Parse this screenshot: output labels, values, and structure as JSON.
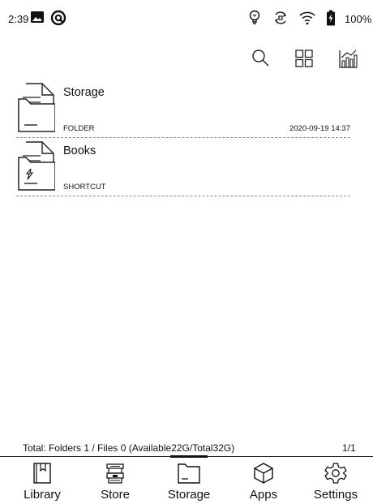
{
  "status": {
    "time": "2:39",
    "battery": "100%"
  },
  "toolbar": {
    "icons": [
      "search-icon",
      "grid-view-icon",
      "statistics-icon"
    ]
  },
  "items": [
    {
      "name": "Storage",
      "type": "FOLDER",
      "date": "2020-09-19 14:37",
      "icon": "folder-icon"
    },
    {
      "name": "Books",
      "type": "SHORTCUT",
      "date": "",
      "icon": "shortcut-folder-icon"
    }
  ],
  "footer": {
    "summary": "Total: Folders 1 / Files 0 (Available22G/Total32G)",
    "page": "1/1"
  },
  "nav": {
    "items": [
      {
        "label": "Library",
        "icon": "library-icon"
      },
      {
        "label": "Store",
        "icon": "store-icon"
      },
      {
        "label": "Storage",
        "icon": "storage-icon"
      },
      {
        "label": "Apps",
        "icon": "apps-icon"
      },
      {
        "label": "Settings",
        "icon": "settings-icon"
      }
    ],
    "active": "Storage"
  }
}
